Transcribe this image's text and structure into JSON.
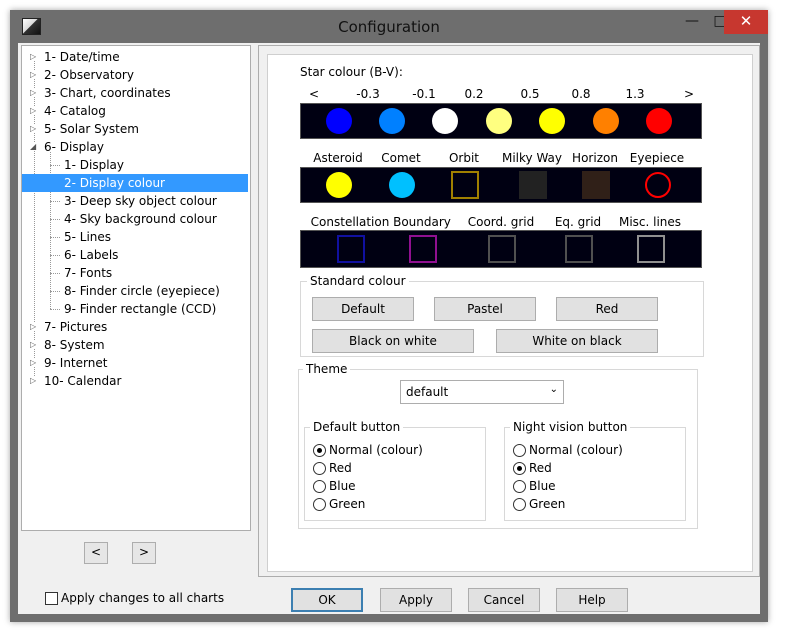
{
  "window": {
    "title": "Configuration",
    "min": "—",
    "max": "□",
    "close": "✕"
  },
  "tree": [
    {
      "label": "1- Date/time",
      "level": 0,
      "expander": "▷"
    },
    {
      "label": "2- Observatory",
      "level": 0,
      "expander": "▷"
    },
    {
      "label": "3- Chart, coordinates",
      "level": 0,
      "expander": "▷"
    },
    {
      "label": "4- Catalog",
      "level": 0,
      "expander": "▷"
    },
    {
      "label": "5- Solar System",
      "level": 0,
      "expander": "▷"
    },
    {
      "label": "6- Display",
      "level": 0,
      "expander": "◢"
    },
    {
      "label": "1- Display",
      "level": 1
    },
    {
      "label": "2- Display colour",
      "level": 1,
      "selected": true
    },
    {
      "label": "3- Deep sky object colour",
      "level": 1
    },
    {
      "label": "4- Sky background colour",
      "level": 1
    },
    {
      "label": "5- Lines",
      "level": 1
    },
    {
      "label": "6- Labels",
      "level": 1
    },
    {
      "label": "7- Fonts",
      "level": 1
    },
    {
      "label": "8- Finder circle (eyepiece)",
      "level": 1
    },
    {
      "label": "9- Finder rectangle (CCD)",
      "level": 1
    },
    {
      "label": "7- Pictures",
      "level": 0,
      "expander": "▷"
    },
    {
      "label": "8- System",
      "level": 0,
      "expander": "▷"
    },
    {
      "label": "9- Internet",
      "level": 0,
      "expander": "▷"
    },
    {
      "label": "10- Calendar",
      "level": 0,
      "expander": "▷"
    }
  ],
  "nav": {
    "prev": "<",
    "next": ">"
  },
  "star_colour": {
    "title": "Star colour (B-V):",
    "scale": [
      "<",
      "-0.3",
      "-0.1",
      "0.2",
      "0.5",
      "0.8",
      "1.3",
      ">"
    ],
    "colors": [
      "#0000ff",
      "#0080ff",
      "#ffffff",
      "#ffff80",
      "#ffff00",
      "#ff8000",
      "#ff0000"
    ]
  },
  "objects": [
    {
      "label": "Asteroid",
      "color": "#ffff00",
      "shape": "filled"
    },
    {
      "label": "Comet",
      "color": "#00c0ff",
      "shape": "filled"
    },
    {
      "label": "Orbit",
      "color": "#a08000",
      "shape": "square-outline"
    },
    {
      "label": "Milky Way",
      "color": "#222222",
      "shape": "square-filled"
    },
    {
      "label": "Horizon",
      "color": "#302018",
      "shape": "square-filled"
    },
    {
      "label": "Eyepiece",
      "color": "#ff0000",
      "shape": "circle-outline"
    }
  ],
  "lines": [
    {
      "label": "Constellation",
      "color": "#1010a0"
    },
    {
      "label": "Boundary",
      "color": "#901090"
    },
    {
      "label": "Coord. grid",
      "color": "#505050"
    },
    {
      "label": "Eq. grid",
      "color": "#505050"
    },
    {
      "label": "Misc. lines",
      "color": "#909090"
    }
  ],
  "standard_colour": {
    "title": "Standard  colour",
    "buttons": [
      "Default",
      "Pastel",
      "Red",
      "Black on white",
      "White on black"
    ]
  },
  "theme": {
    "title": "Theme",
    "value": "default",
    "default_button": {
      "title": "Default button",
      "options": [
        "Normal (colour)",
        "Red",
        "Blue",
        "Green"
      ],
      "selected": 0
    },
    "night_button": {
      "title": "Night vision button",
      "options": [
        "Normal (colour)",
        "Red",
        "Blue",
        "Green"
      ],
      "selected": 1
    }
  },
  "bottom": {
    "apply_all": "Apply changes to all charts",
    "ok": "OK",
    "apply": "Apply",
    "cancel": "Cancel",
    "help": "Help"
  }
}
